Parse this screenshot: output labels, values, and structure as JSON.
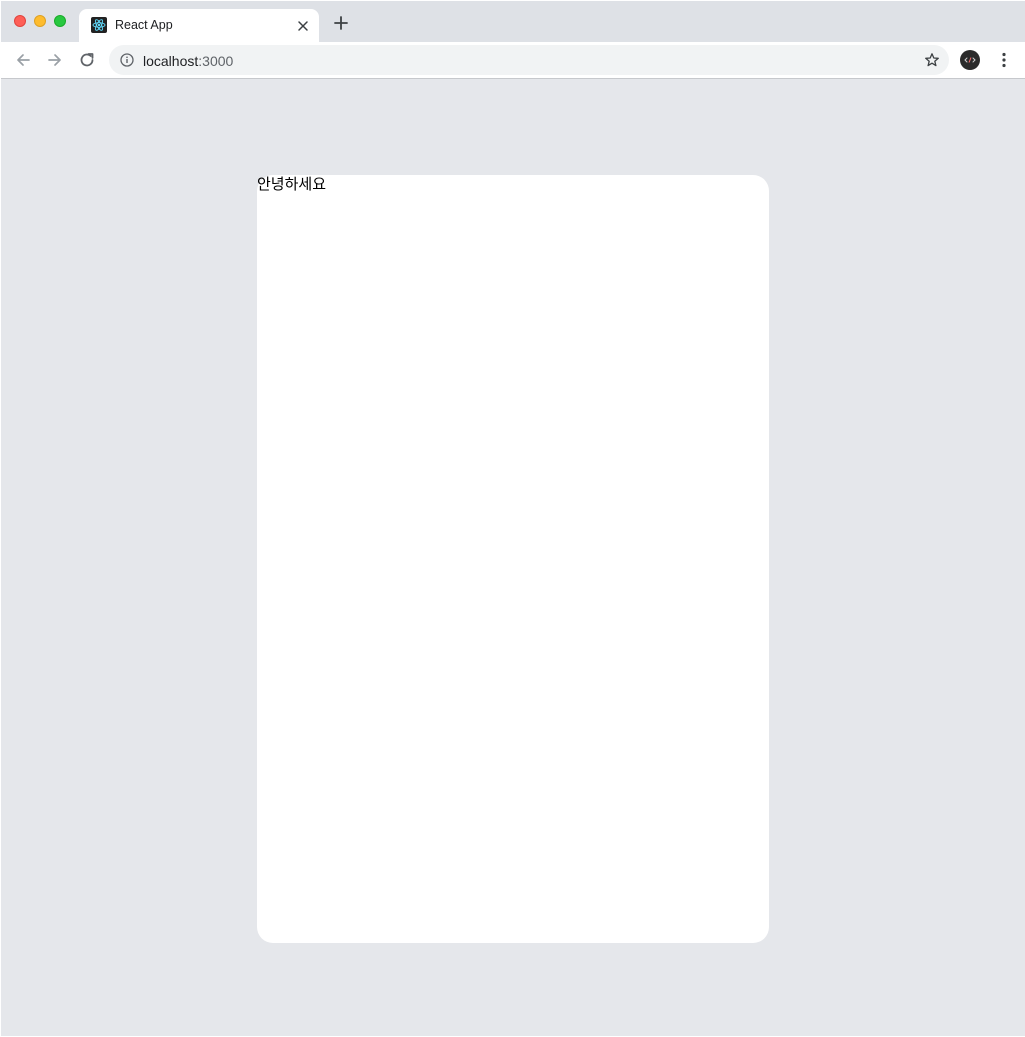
{
  "browser": {
    "tab": {
      "title": "React App",
      "favicon": "react-icon"
    },
    "address": {
      "host": "localhost",
      "port": ":3000"
    },
    "icons": {
      "back": "arrow-left-icon",
      "forward": "arrow-right-icon",
      "reload": "reload-icon",
      "info": "info-icon",
      "bookmark": "star-icon",
      "extension": "extension-avatar-icon",
      "menu": "kebab-menu-icon",
      "close_tab": "close-icon",
      "new_tab": "plus-icon"
    }
  },
  "page": {
    "background": "#e5e7eb",
    "card_background": "#ffffff",
    "greeting": "안녕하세요"
  }
}
